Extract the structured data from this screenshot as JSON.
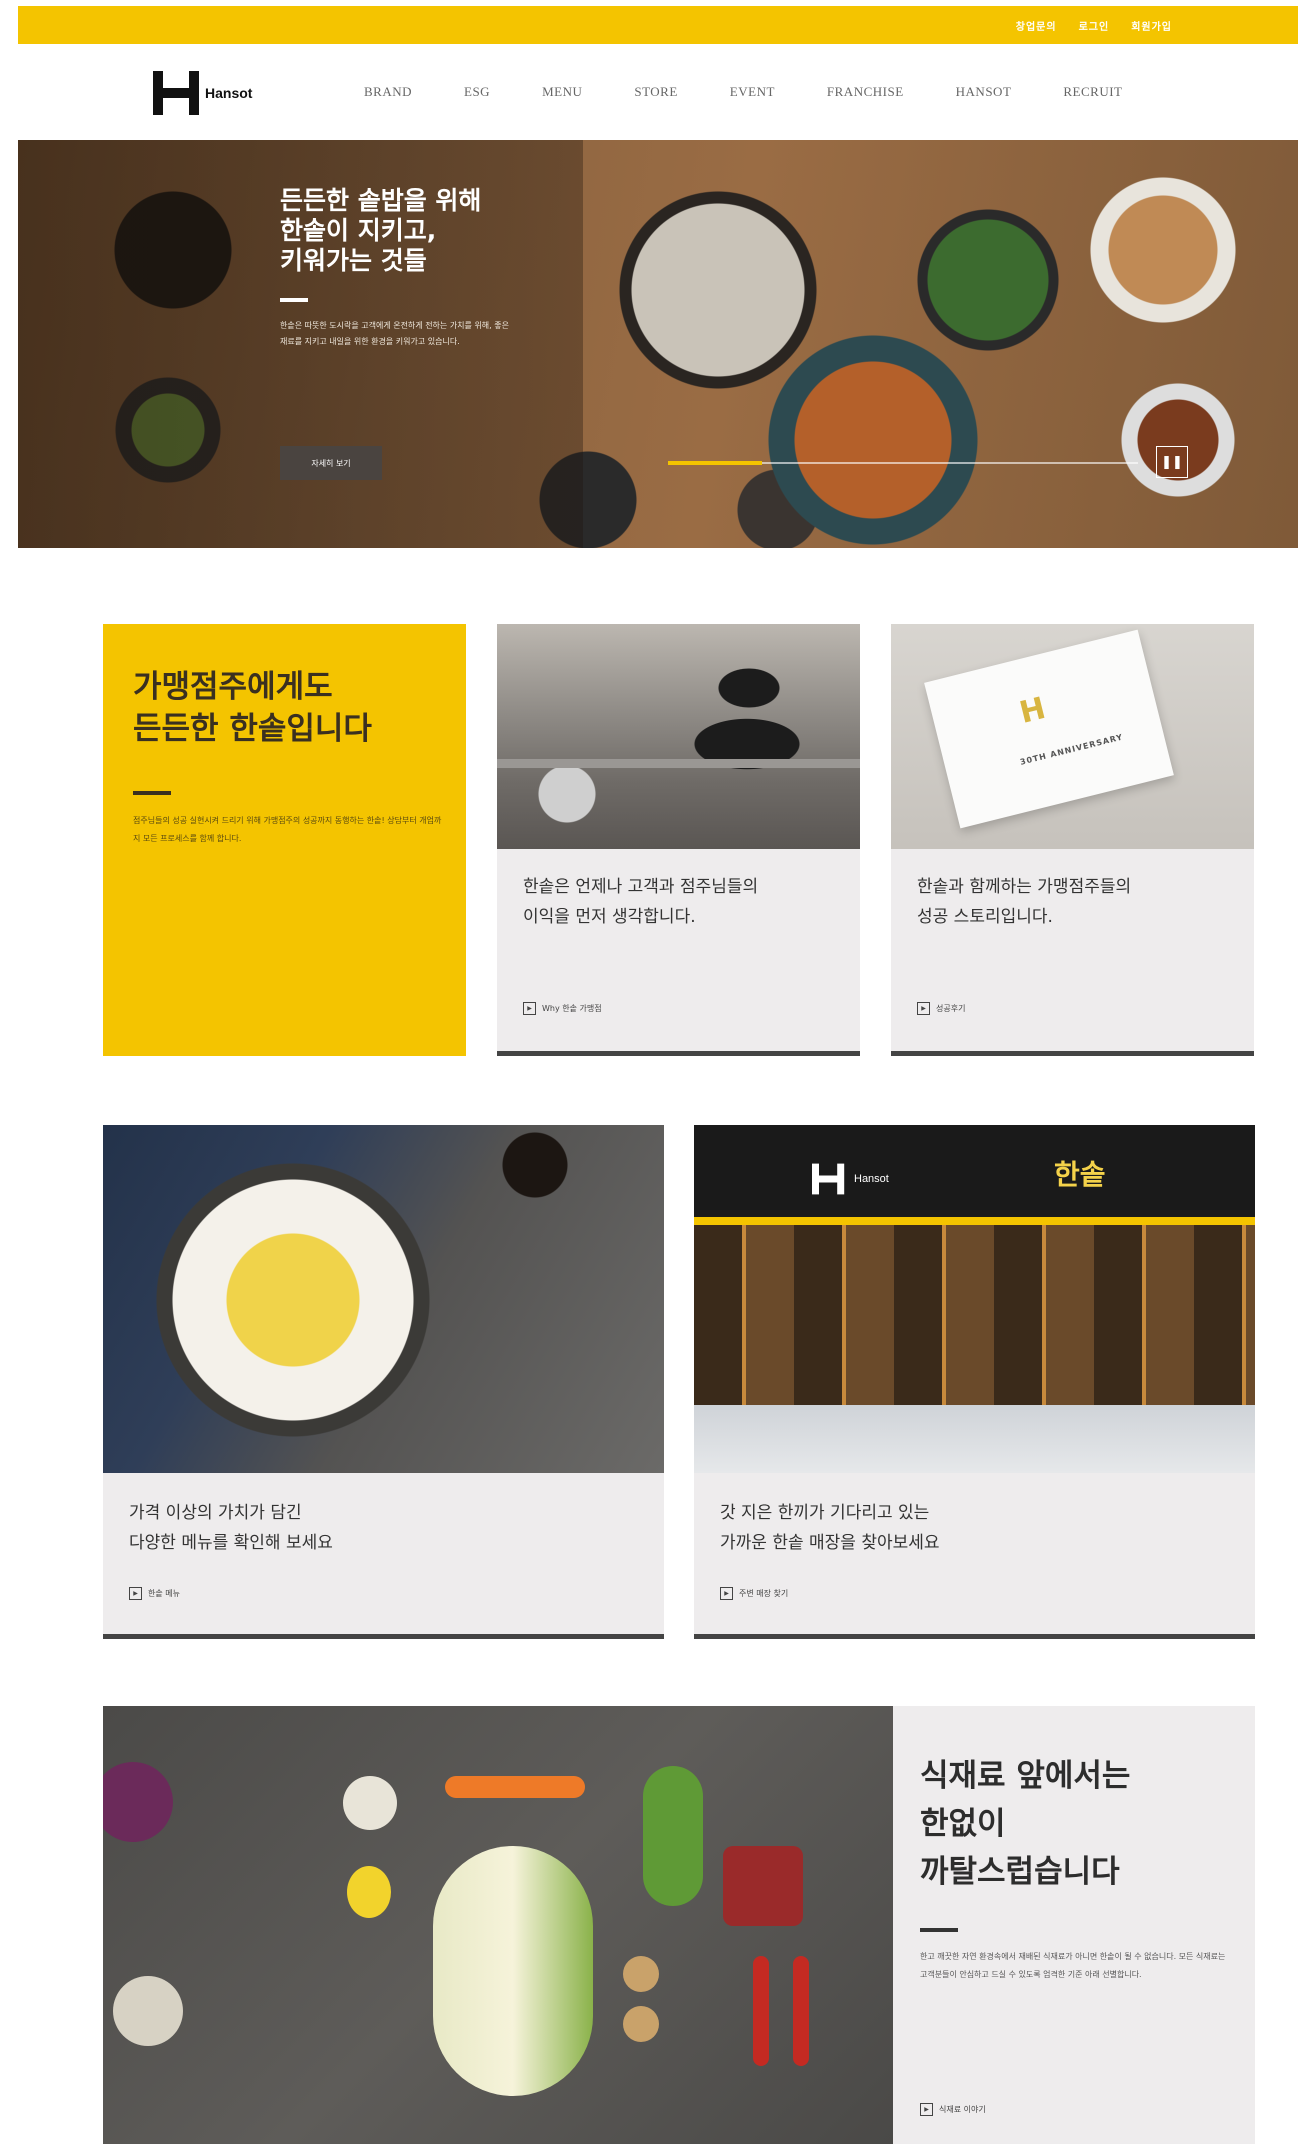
{
  "topbar": {
    "links": [
      "창업문의",
      "로그인",
      "회원가입"
    ],
    "color": "#f4c400"
  },
  "header": {
    "logo_text": "Hansot",
    "nav": [
      "BRAND",
      "ESG",
      "MENU",
      "STORE",
      "EVENT",
      "FRANCHISE",
      "HANSOT",
      "RECRUIT"
    ]
  },
  "hero": {
    "title_lines": [
      "든든한 솥밥을 위해",
      "한솥이 지키고,",
      "키워가는 것들"
    ],
    "description": "한솥은 따뜻한 도시락을 고객에게 온전하게 전하는 가치를 위해, 좋은 재료를 지키고 내일을 위한 환경을 키워가고 있습니다.",
    "button": "자세히 보기",
    "pause_icon": "pause-icon",
    "progress": 0.2
  },
  "franchise": {
    "title_lines": [
      "가맹점주에게도",
      "든든한 한솥입니다"
    ],
    "description": "점주님들의 성공 실현시켜 드리기 위해 가맹점주의 성공까지 동행하는 한솥! 상담부터 개업까지 모든 프로세스를 함께 합니다."
  },
  "card_why": {
    "text_lines": [
      "한솥은 언제나 고객과 점주님들의",
      "이익을 먼저 생각합니다."
    ],
    "link": "Why 한솥 가맹점"
  },
  "card_story": {
    "text_lines": [
      "한솥과 함께하는 가맹점주들의",
      "성공 스토리입니다."
    ],
    "link": "성공후기",
    "image_title": "30TH ANNIVERSARY"
  },
  "card_menu": {
    "text_lines": [
      "가격 이상의 가치가 담긴",
      "다양한 메뉴를 확인해 보세요"
    ],
    "link": "한솥 메뉴"
  },
  "card_store": {
    "text_lines": [
      "갓 지은 한끼가 기다리고 있는",
      "가까운 한솥 매장을 찾아보세요"
    ],
    "link": "주변 매장 찾기",
    "sign_en": "Hansot",
    "sign_kr": "한솥"
  },
  "ingredients": {
    "title_lines": [
      "식재료 앞에서는",
      "한없이",
      "까탈스럽습니다"
    ],
    "description": "한고 깨끗한 자연 환경속에서 재배된 식재료가 아니면 한솥이 될 수 없습니다. 모든 식재료는 고객분들이 안심하고 드실 수 있도록 엄격한 기준 아래 선별합니다.",
    "link": "식재료 이야기"
  },
  "colors": {
    "accent": "#f4c400",
    "card_bg": "#eeeced",
    "text_dark": "#333333"
  }
}
